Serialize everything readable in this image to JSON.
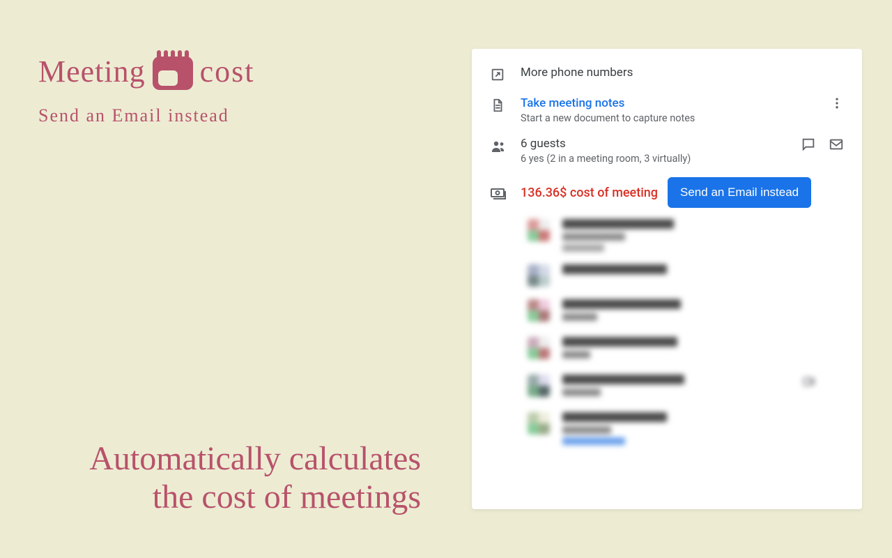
{
  "brand": {
    "word1": "Meeting",
    "word2": "cost",
    "tagline": "Send an Email instead"
  },
  "headline_line1": "Automatically calculates",
  "headline_line2": "the cost of meetings",
  "card": {
    "more_phone": "More phone numbers",
    "notes_title": "Take meeting notes",
    "notes_sub": "Start a new document to capture notes",
    "guests_title": "6 guests",
    "guests_sub": "6 yes (2 in a meeting room, 3 virtually)",
    "cost_text": "136.36$ cost of meeting",
    "cta_label": "Send an Email instead"
  }
}
